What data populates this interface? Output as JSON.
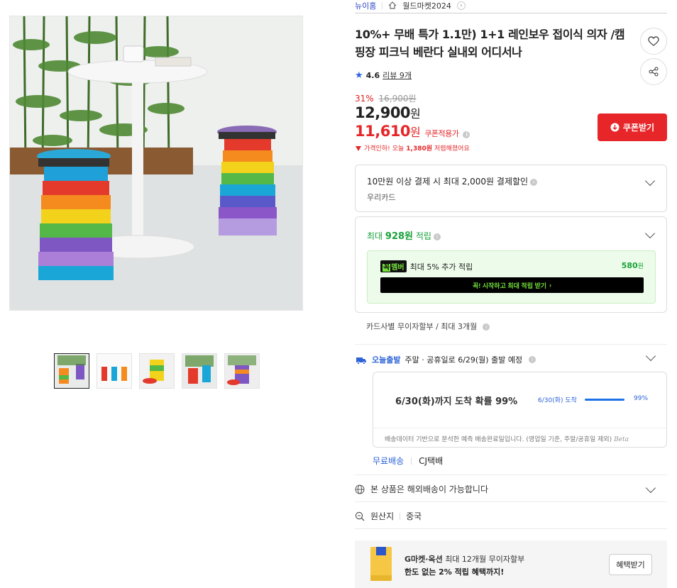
{
  "breadcrumb": {
    "brand": "뉴이홈",
    "store": "월드마켓2024"
  },
  "product": {
    "title": "10%+ 무배 특가 1.1만) 1+1 레인보우 접이식 의자 /캠핑장 피크닉 베란다 실내외 어디서나",
    "rating": "4.6",
    "review_label": "리뷰 9개",
    "discount_pct": "31%",
    "original_price": "16,900원",
    "price": "12,900",
    "price_unit": "원",
    "coupon_price": "11,610",
    "coupon_unit": "원",
    "coupon_tag": "쿠폰적용가",
    "price_drop_prefix": "가격인하!",
    "price_drop_text": "오늘",
    "price_drop_amount": "1,380원",
    "price_drop_suffix": "저렴해졌어요",
    "coupon_button": "쿠폰받기"
  },
  "card_discount": {
    "title": "10만원 이상 결제 시 최대 2,000원 결제할인",
    "card": "우리카드"
  },
  "points": {
    "prefix": "최대",
    "amount": "928원",
    "suffix": "적립",
    "member_badge_a": "꼭",
    "member_badge_b": "멤버",
    "member_text": "최대 5% 추가 적립",
    "member_points": "580",
    "member_points_unit": "원",
    "member_cta": "꼭! 시작하고 최대 적립 받기"
  },
  "installment": "카드사별 무이자할부 / 최대 3개월",
  "shipping": {
    "today_label": "오늘출발",
    "schedule": "주말 · 공휴일로 6/29(월) 출발 예정",
    "probability": "6/30(화)까지 도착 확률 99%",
    "arrival_date": "6/30(화) 도착",
    "arrival_pct": "99%",
    "arrival_ratio": 0.99,
    "note": "배송데이터 기반으로 분석한 예측 배송완료일입니다. (영업일 기준, 주말/공휴일 제외)",
    "beta": "Beta",
    "free_shipping": "무료배송",
    "carrier": "CJ택배"
  },
  "overseas": "본 상품은 해외배송이 가능합니다",
  "origin": {
    "label": "원산지",
    "value": "중국"
  },
  "promo": {
    "brand": "G마켓·옥션",
    "line1": "최대 12개월 무이자할부",
    "line2": "한도 없는 2% 적립 혜택까지!",
    "button": "혜택받기"
  },
  "colors": {
    "accent_red": "#e7262a",
    "link_blue": "#2d63d8",
    "point_green": "#19a23a"
  }
}
